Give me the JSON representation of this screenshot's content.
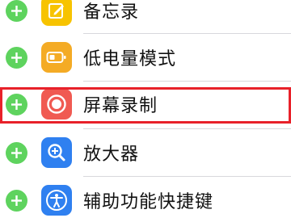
{
  "colors": {
    "add_button": "#5ed35e",
    "highlight_border": "#e8212a",
    "notes_icon": "#f7c300",
    "low_power_icon": "#f4ab25",
    "screen_record_icon": "#f05a52",
    "magnifier_icon": "#2f80f0",
    "accessibility_icon": "#2f80f0"
  },
  "items": [
    {
      "label": "备忘录",
      "icon": "notes-icon"
    },
    {
      "label": "低电量模式",
      "icon": "battery-icon"
    },
    {
      "label": "屏幕录制",
      "icon": "record-icon",
      "highlighted": true
    },
    {
      "label": "放大器",
      "icon": "magnifier-icon"
    },
    {
      "label": "辅助功能快捷键",
      "icon": "accessibility-icon"
    }
  ]
}
